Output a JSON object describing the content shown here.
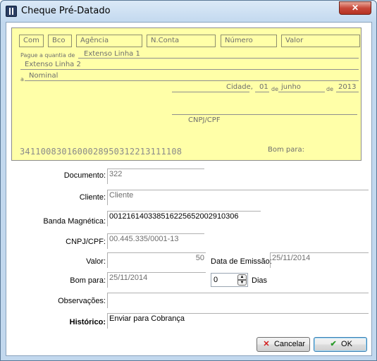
{
  "window": {
    "title": "Cheque Pré-Datado",
    "close_glyph": "✕"
  },
  "cheque": {
    "boxes": [
      "Com",
      "Bco",
      "Agência",
      "N.Conta",
      "Número",
      "Valor"
    ],
    "pague_label": "Pague a quantia de",
    "extenso1": "Extenso Linha 1",
    "extenso2": "Extenso Linha 2",
    "a_label": "a",
    "nominal": "Nominal",
    "cidade": "Cidade,",
    "dia": "01",
    "de1": "de",
    "mes": "junho",
    "de2": "de",
    "ano": "2013",
    "cnpj_label": "CNPJ/CPF",
    "micr": "3411008301600028950312213111108",
    "bom_para_label": "Bom para:"
  },
  "form": {
    "documento_label": "Documento:",
    "documento_value": "322",
    "cliente_label": "Cliente:",
    "cliente_value": "Cliente",
    "banda_label": "Banda Magnética:",
    "banda_value": "001216140338516225652002910306",
    "cnpj_label": "CNPJ/CPF:",
    "cnpj_value": "00.445.335/0001-13",
    "valor_label": "Valor:",
    "valor_value": "50",
    "emissao_label": "Data de Emissão:",
    "emissao_value": "25/11/2014",
    "bom_para_label": "Bom para:",
    "bom_para_value": "25/11/2014",
    "dias_value": "0",
    "dias_label": "Dias",
    "observacoes_label": "Observações:",
    "observacoes_value": "",
    "historico_label": "Histórico:",
    "historico_value": "Enviar para Cobrança"
  },
  "buttons": {
    "cancel_label": "Cancelar",
    "ok_label": "OK"
  },
  "icons": {
    "cancel": "x-icon",
    "ok": "check-icon"
  },
  "colors": {
    "cheque_bg": "#ffffa8",
    "cancel_icon": "#d21c1c",
    "ok_icon": "#2a9a2a"
  }
}
